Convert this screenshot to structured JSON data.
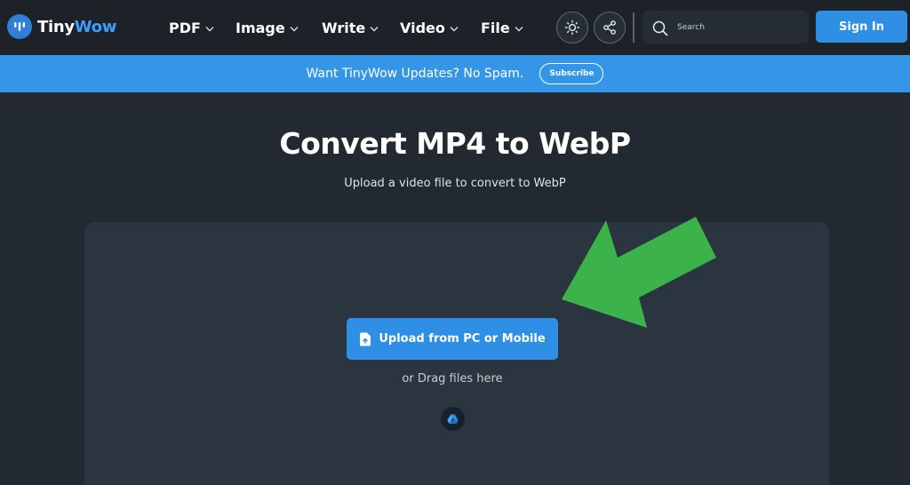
{
  "brand": {
    "name_part1": "Tiny",
    "name_part2": "Wow",
    "accent_color": "#3aa0ff"
  },
  "nav": {
    "items": [
      {
        "label": "PDF"
      },
      {
        "label": "Image"
      },
      {
        "label": "Write"
      },
      {
        "label": "Video"
      },
      {
        "label": "File"
      }
    ],
    "theme_icon": "sun-icon",
    "share_icon": "share-icon"
  },
  "search": {
    "placeholder": "Search",
    "icon": "search-icon"
  },
  "auth": {
    "sign_in_label": "Sign In"
  },
  "banner": {
    "text": "Want TinyWow Updates? No Spam.",
    "subscribe_label": "Subscribe",
    "color": "#3596e8"
  },
  "hero": {
    "title": "Convert MP4 to WebP",
    "subtitle": "Upload a video file to convert to WebP"
  },
  "upload": {
    "button_label": "Upload from PC or Mobile",
    "button_icon": "file-upload-icon",
    "drag_text": "or Drag files here",
    "cloud_icon": "google-drive-icon",
    "button_color": "#2f8fe4"
  },
  "annotation": {
    "arrow_color": "#3cb34a",
    "arrow_icon": "pointer-arrow-icon"
  }
}
